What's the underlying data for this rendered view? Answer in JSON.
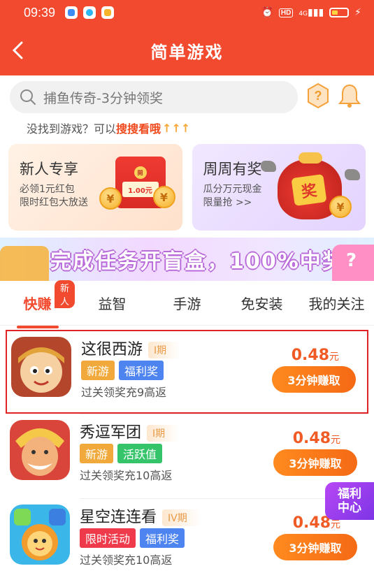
{
  "status": {
    "time": "09:39",
    "network": "4G"
  },
  "nav": {
    "title": "简单游戏"
  },
  "search": {
    "placeholder": "捕鱼传奇-3分钟领奖"
  },
  "hint": {
    "prefix": "没找到游戏？可以",
    "link": "搜搜看哦",
    "arrows": "↑↑↑"
  },
  "banners": [
    {
      "title": "新人专享",
      "line1": "必领1元红包",
      "line2": "限时红包大放送",
      "amount": "1.00元",
      "seal": "開",
      "coin_symbol": "¥"
    },
    {
      "title": "周周有奖",
      "line1": "瓜分万元现金",
      "line2": "限量抢 >>",
      "bag_tag": "奖",
      "coin_symbol": "¥"
    }
  ],
  "promo": {
    "text": "完成任务开盲盒，100%中奖"
  },
  "tabs": [
    {
      "label": "快赚",
      "badge": "新人"
    },
    {
      "label": "益智"
    },
    {
      "label": "手游"
    },
    {
      "label": "免安装"
    },
    {
      "label": "我的关注"
    }
  ],
  "games": [
    {
      "name": "这很西游",
      "phase": "I期",
      "tags": [
        {
          "text": "新游"
        },
        {
          "text": "福利奖"
        }
      ],
      "desc": "过关领奖充9高返",
      "price": "0.48",
      "unit": "元",
      "button": "3分钟赚取"
    },
    {
      "name": "秀逗军团",
      "phase": "I期",
      "tags": [
        {
          "text": "新游"
        },
        {
          "text": "活跃值"
        }
      ],
      "desc": "过关领奖充10高返",
      "price": "0.48",
      "unit": "元",
      "button": "3分钟赚取"
    },
    {
      "name": "星空连连看",
      "phase": "IV期",
      "tags": [
        {
          "text": "限时活动"
        },
        {
          "text": "福利奖"
        }
      ],
      "desc": "过关领奖充10高返",
      "price": "0.48",
      "unit": "元",
      "button": "3分钟赚取"
    }
  ],
  "float": {
    "line1": "福利",
    "line2": "中心"
  },
  "colors": {
    "brand": "#f24a2e",
    "button": "#f56a15",
    "price": "#f05a24",
    "float": "#9b3ff0"
  }
}
